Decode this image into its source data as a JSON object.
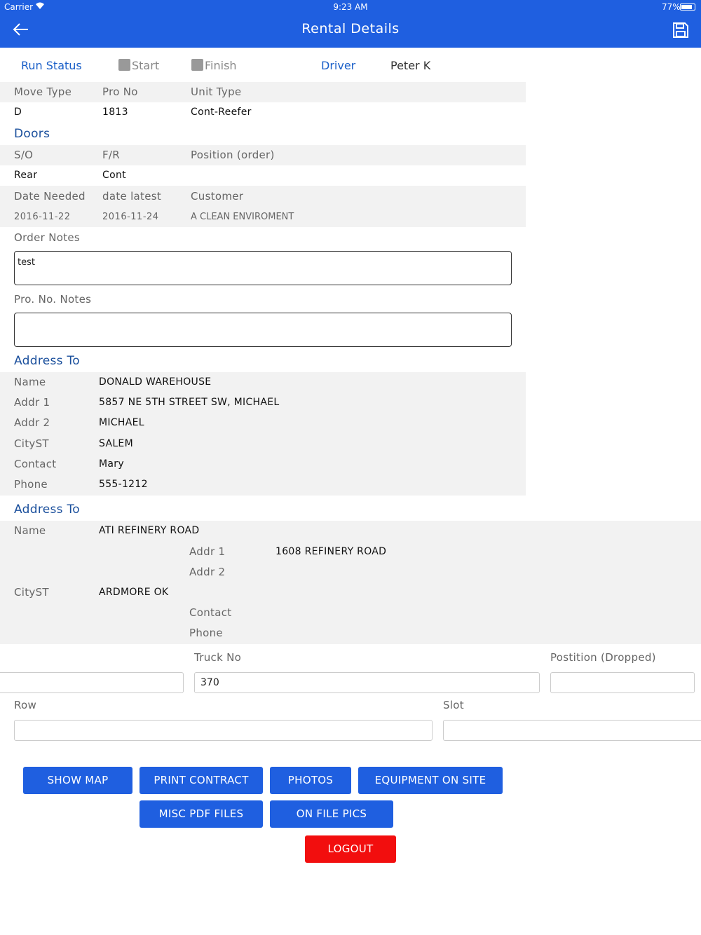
{
  "status_bar": {
    "carrier": "Carrier",
    "time": "9:23 AM",
    "battery": "77%"
  },
  "nav": {
    "title": "Rental Details",
    "back_icon": "arrow-left-icon",
    "save_icon": "floppy-disk-icon"
  },
  "run": {
    "run_status_label": "Run Status",
    "start_label": "Start",
    "finish_label": "Finish",
    "driver_label": "Driver",
    "driver_value": "Peter K"
  },
  "move": {
    "move_type_label": "Move Type",
    "pro_no_label": "Pro No",
    "unit_type_label": "Unit Type",
    "move_type": "D",
    "pro_no": "1813",
    "unit_type": "Cont-Reefer"
  },
  "doors": {
    "title": "Doors",
    "so_label": "S/O",
    "fr_label": "F/R",
    "position_label": "Position (order)",
    "so": "Rear",
    "fr": "Cont",
    "position": ""
  },
  "dates": {
    "date_needed_label": "Date Needed",
    "date_latest_label": "date latest",
    "customer_label": "Customer",
    "date_needed": "2016-11-22",
    "date_latest": "2016-11-24",
    "customer": "A CLEAN ENVIROMENT"
  },
  "notes": {
    "order_notes_label": "Order Notes",
    "order_notes": "test",
    "pro_notes_label": "Pro. No. Notes",
    "pro_notes": ""
  },
  "address_to_1": {
    "title": "Address To",
    "rows": [
      {
        "label": "Name",
        "value": "DONALD WAREHOUSE"
      },
      {
        "label": "Addr 1",
        "value": "5857 NE 5TH STREET SW, MICHAEL"
      },
      {
        "label": "Addr 2",
        "value": "MICHAEL"
      },
      {
        "label": "CityST",
        "value": "SALEM"
      },
      {
        "label": "Contact",
        "value": "Mary"
      },
      {
        "label": "Phone",
        "value": "555-1212"
      }
    ]
  },
  "address_to_2": {
    "title": "Address To",
    "name_label": "Name",
    "name": "ATI REFINERY ROAD",
    "addr1_label": "Addr 1",
    "addr1": "1608 REFINERY ROAD",
    "addr2_label": "Addr 2",
    "addr2": "",
    "cityst_label": "CityST",
    "cityst": "ARDMORE OK",
    "contact_label": "Contact",
    "contact": "",
    "phone_label": "Phone",
    "phone": ""
  },
  "drop": {
    "truck_no_label": "Truck No",
    "truck_no": "370",
    "position_dropped_label": "Postition (Dropped)",
    "position_dropped": "",
    "unlabeled_field": "",
    "row_label": "Row",
    "row": "",
    "slot_label": "Slot",
    "slot": ""
  },
  "buttons": {
    "show_map": "SHOW MAP",
    "print_contract": "PRINT CONTRACT",
    "photos": "PHOTOS",
    "equipment_on_site": "EQUIPMENT ON SITE",
    "misc_pdf_files": "MISC PDF FILES",
    "on_file_pics": "ON FILE PICS",
    "logout": "LOGOUT"
  },
  "colors": {
    "primary": "#1f5fe0",
    "logout": "#f20e0e",
    "section_title": "#1a4f9c",
    "row_bg": "#f2f2f2"
  }
}
